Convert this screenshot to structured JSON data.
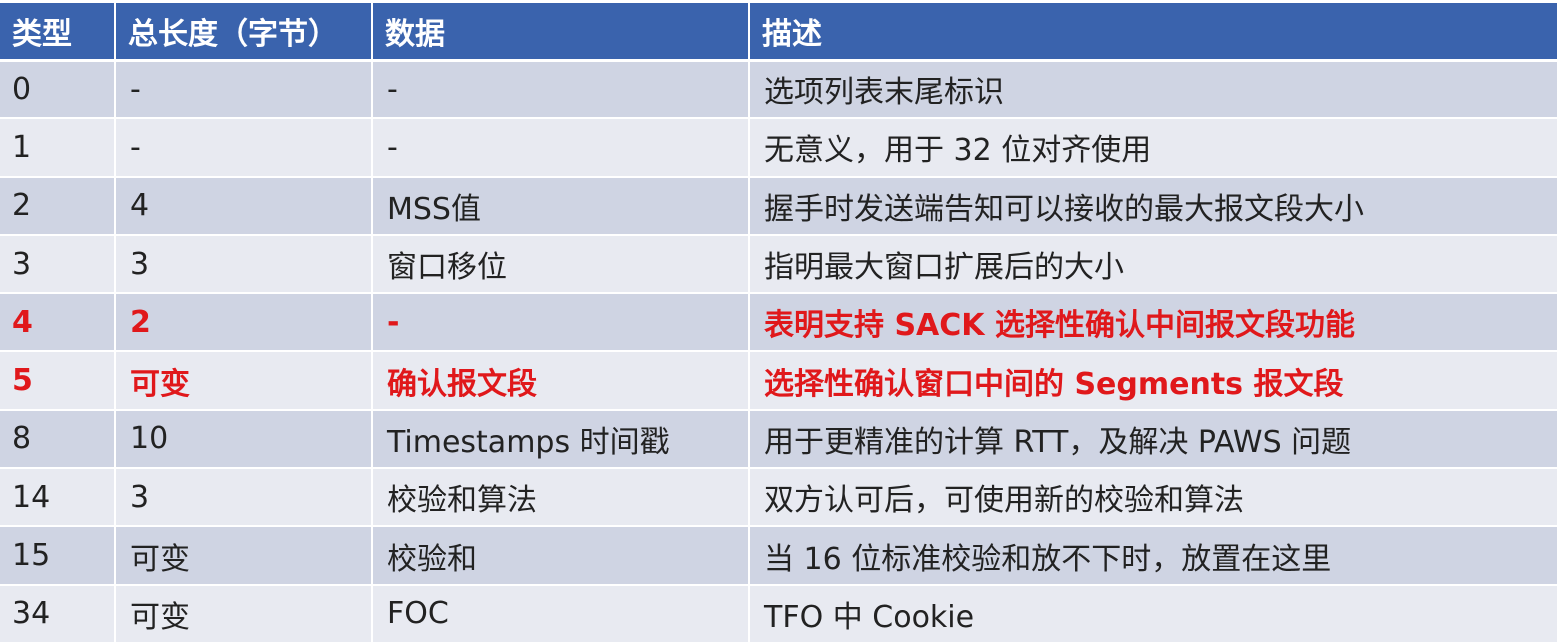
{
  "table": {
    "headers": [
      "类型",
      "总长度（字节）",
      "数据",
      "描述"
    ],
    "rows": [
      {
        "type": "0",
        "length": "-",
        "data": "-",
        "desc": "选项列表末尾标识",
        "highlight": false
      },
      {
        "type": "1",
        "length": "-",
        "data": "-",
        "desc": "无意义，用于 32 位对齐使用",
        "highlight": false
      },
      {
        "type": "2",
        "length": "4",
        "data": "MSS值",
        "desc": "握手时发送端告知可以接收的最大报文段大小",
        "highlight": false
      },
      {
        "type": "3",
        "length": "3",
        "data": "窗口移位",
        "desc": "指明最大窗口扩展后的大小",
        "highlight": false
      },
      {
        "type": "4",
        "length": "2",
        "data": "-",
        "desc": "表明支持 SACK 选择性确认中间报文段功能",
        "highlight": true
      },
      {
        "type": "5",
        "length": "可变",
        "data": "确认报文段",
        "desc": "选择性确认窗口中间的 Segments 报文段",
        "highlight": true
      },
      {
        "type": "8",
        "length": "10",
        "data": "Timestamps 时间戳",
        "desc": "用于更精准的计算 RTT，及解决 PAWS 问题",
        "highlight": false
      },
      {
        "type": "14",
        "length": "3",
        "data": "校验和算法",
        "desc": "双方认可后，可使用新的校验和算法",
        "highlight": false
      },
      {
        "type": "15",
        "length": "可变",
        "data": "校验和",
        "desc": "当 16 位标准校验和放不下时，放置在这里",
        "highlight": false
      },
      {
        "type": "34",
        "length": "可变",
        "data": "FOC",
        "desc": "TFO 中 Cookie",
        "highlight": false
      }
    ]
  },
  "colors": {
    "header_bg": "#3a63ad",
    "row_odd": "#cfd4e3",
    "row_even": "#e8eaf1",
    "highlight_text": "#e0181b"
  }
}
